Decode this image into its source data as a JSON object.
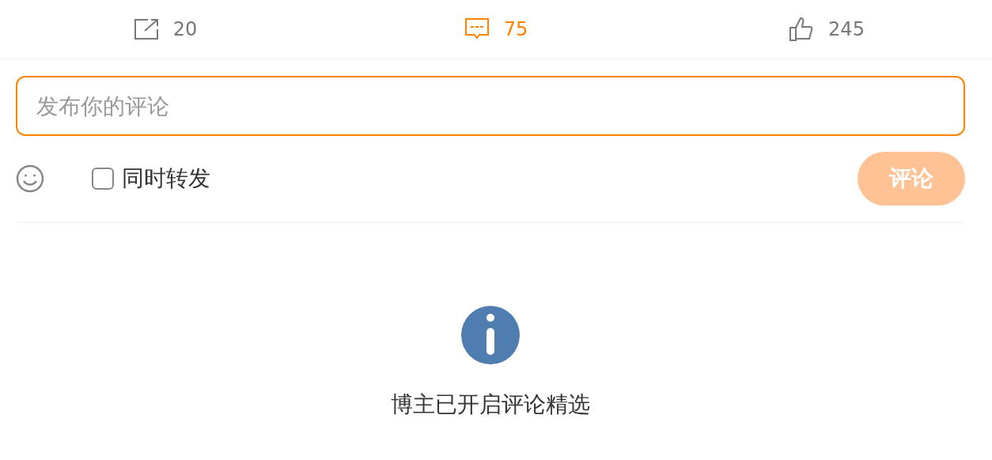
{
  "actions": [
    {
      "kind": "repost",
      "count": "20",
      "selected": false
    },
    {
      "kind": "comment",
      "count": "75",
      "selected": true
    },
    {
      "kind": "like",
      "count": "245",
      "selected": false
    }
  ],
  "comment_box": {
    "placeholder": "发布你的评论",
    "focused": true
  },
  "repost_option": {
    "label": "同时转发",
    "checked": false
  },
  "submit_button": {
    "label": "评论",
    "disabled": true
  },
  "notice": {
    "text": "博主已开启评论精选"
  }
}
